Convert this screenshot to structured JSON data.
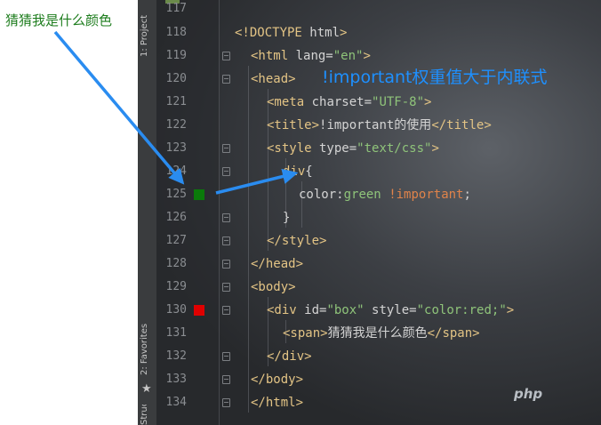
{
  "preview": {
    "text": "猜猜我是什么颜色",
    "text_color": "#1e7d1e"
  },
  "tool_window_bar": {
    "project_label": "1: Project",
    "favorites_label": "2: Favorites",
    "structure_label": "Structure"
  },
  "annotation": {
    "text": "!important权重值大于内联式",
    "color": "#1e90ff"
  },
  "watermark": "php",
  "color_swatches": {
    "green": "#0a7a0a",
    "red": "#e00000"
  },
  "editor": {
    "lines": [
      {
        "no": "117",
        "code": ""
      },
      {
        "no": "118",
        "code": "<!DOCTYPE html>"
      },
      {
        "no": "119",
        "code": "<html lang=\"en\">"
      },
      {
        "no": "120",
        "code": "<head>"
      },
      {
        "no": "121",
        "code": "<meta charset=\"UTF-8\">"
      },
      {
        "no": "122",
        "code": "<title>!important的使用</title>"
      },
      {
        "no": "123",
        "code": "<style type=\"text/css\">"
      },
      {
        "no": "124",
        "code": "div{"
      },
      {
        "no": "125",
        "code": "color:green !important;"
      },
      {
        "no": "126",
        "code": "}"
      },
      {
        "no": "127",
        "code": "</style>"
      },
      {
        "no": "128",
        "code": "</head>"
      },
      {
        "no": "129",
        "code": "<body>"
      },
      {
        "no": "130",
        "code": "<div id=\"box\" style=\"color:red;\">"
      },
      {
        "no": "131",
        "code": "<span>猜猜我是什么颜色</span>"
      },
      {
        "no": "132",
        "code": "</div>"
      },
      {
        "no": "133",
        "code": "</body>"
      },
      {
        "no": "134",
        "code": "</html>"
      }
    ]
  }
}
